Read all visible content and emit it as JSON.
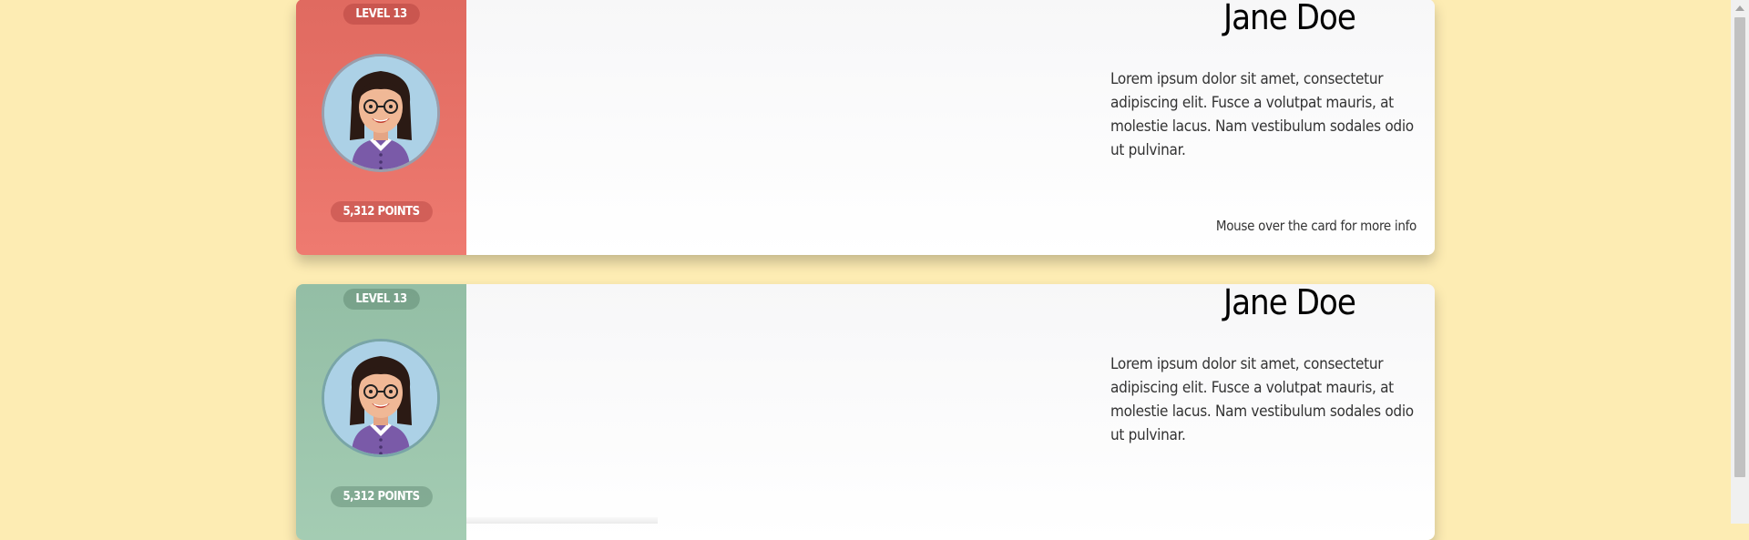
{
  "cards": [
    {
      "level": "LEVEL 13",
      "points": "5,312 POINTS",
      "name": "Jane Doe",
      "description": "Lorem ipsum dolor sit amet, consectetur adipiscing elit. Fusce a volutpat mauris, at molestie lacus. Nam vestibulum sodales odio ut pulvinar.",
      "hint": "Mouse over the card for more info",
      "accent": "#e87068"
    },
    {
      "level": "LEVEL 13",
      "points": "5,312 POINTS",
      "name": "Jane Doe",
      "description": "Lorem ipsum dolor sit amet, consectetur adipiscing elit. Fusce a volutpat mauris, at molestie lacus. Nam vestibulum sodales odio ut pulvinar.",
      "accent": "#9cc5ab"
    }
  ],
  "avatar_icon": "avatar-woman-glasses-icon",
  "colors": {
    "background": "#fdecb3"
  }
}
